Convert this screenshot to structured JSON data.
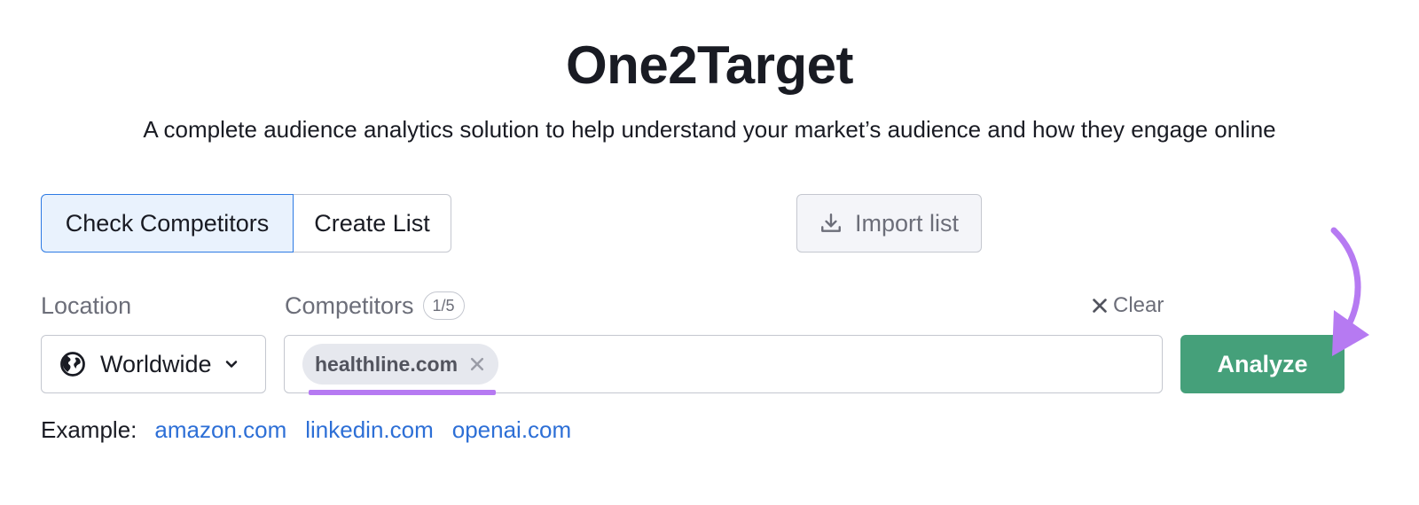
{
  "header": {
    "title": "One2Target",
    "subtitle": "A complete audience analytics solution to help understand your market’s audience and how they engage online"
  },
  "mode_tabs": [
    {
      "label": "Check Competitors",
      "active": true
    },
    {
      "label": "Create List",
      "active": false
    }
  ],
  "import": {
    "label": "Import list",
    "icon": "download-icon"
  },
  "location": {
    "label": "Location",
    "value": "Worldwide",
    "icon": "globe-icon"
  },
  "competitors": {
    "label": "Competitors",
    "count": "1/5",
    "clear_label": "Clear",
    "chips": [
      "healthline.com"
    ]
  },
  "analyze": {
    "label": "Analyze"
  },
  "examples": {
    "label": "Example:",
    "links": [
      "amazon.com",
      "linkedin.com",
      "openai.com"
    ]
  },
  "colors": {
    "accent_blue": "#2d7ae4",
    "analyze_green": "#45a07a",
    "annotation_purple": "#b67af2",
    "link_blue": "#2d6fd6"
  }
}
